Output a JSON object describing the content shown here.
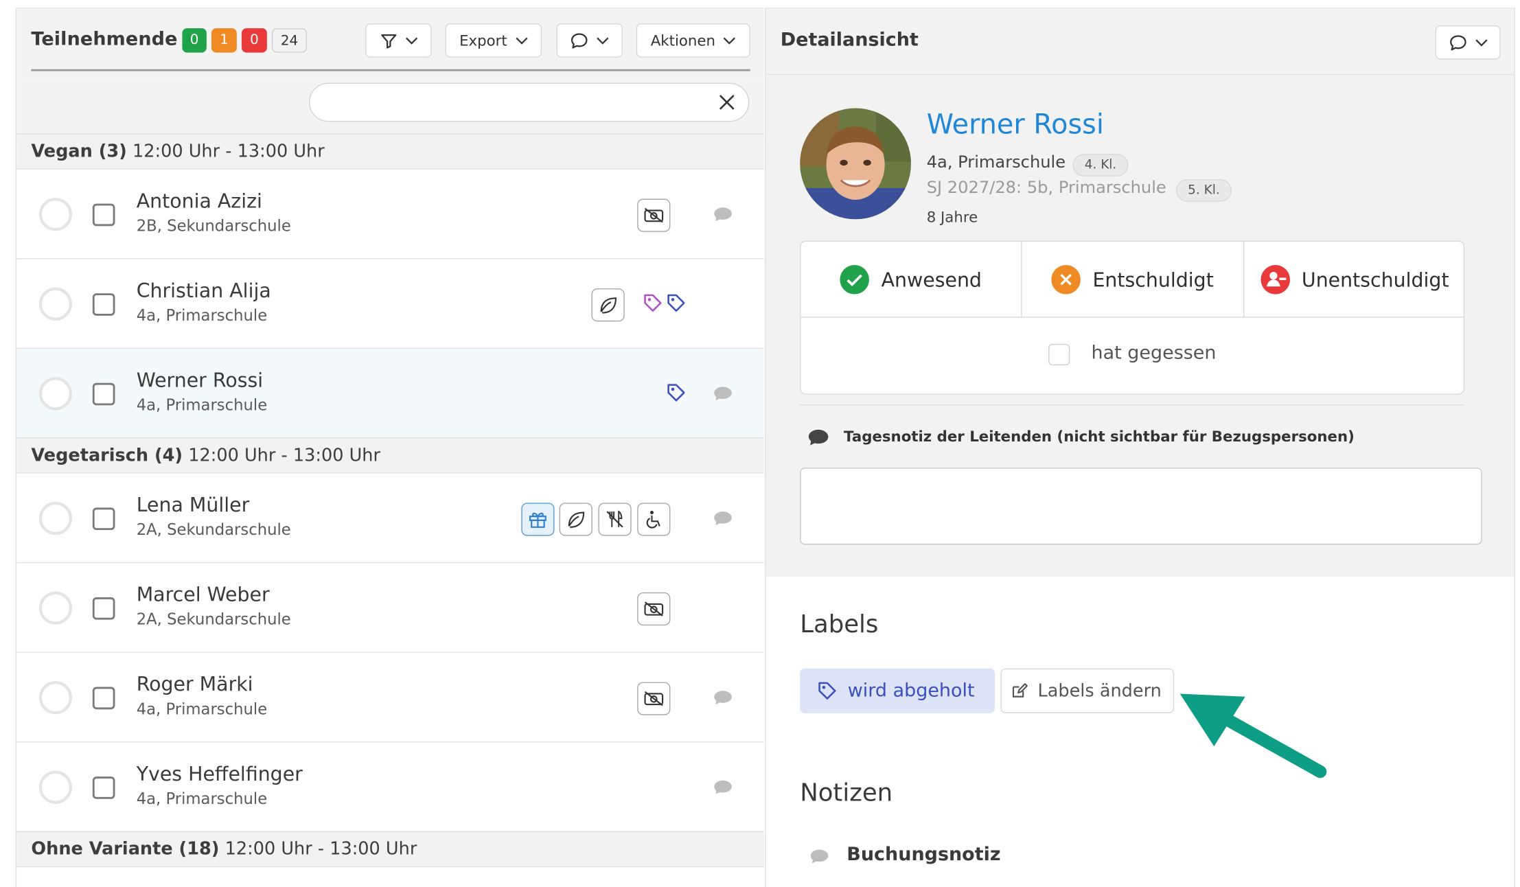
{
  "left_panel": {
    "title": "Teilnehmende",
    "badges": {
      "present": "0",
      "excused": "1",
      "unexcused": "0",
      "total": "24"
    },
    "export_label": "Export",
    "actions_label": "Aktionen",
    "search": {
      "value": "",
      "placeholder": ""
    },
    "groups": [
      {
        "name": "Vegan (3)",
        "time": "12:00 Uhr - 13:00 Uhr"
      },
      {
        "name": "Vegetarisch (4)",
        "time": "12:00 Uhr - 13:00 Uhr"
      },
      {
        "name": "Ohne Variante (18)",
        "time": "12:00 Uhr - 13:00 Uhr"
      }
    ],
    "participants": [
      {
        "name": "Antonia Azizi",
        "class": "2B, Sekundarschule"
      },
      {
        "name": "Christian Alija",
        "class": "4a, Primarschule"
      },
      {
        "name": "Werner Rossi",
        "class": "4a, Primarschule"
      },
      {
        "name": "Lena Müller",
        "class": "2A, Sekundarschule"
      },
      {
        "name": "Marcel Weber",
        "class": "2A, Sekundarschule"
      },
      {
        "name": "Roger Märki",
        "class": "4a, Primarschule"
      },
      {
        "name": "Yves Heffelfinger",
        "class": "4a, Primarschule"
      }
    ],
    "icons": {
      "filter": "filter-funnel-icon",
      "chevron": "chevron-down-icon",
      "comment": "speech-bubble-icon",
      "clear": "close-x-icon",
      "no_photo": "no-photo-icon",
      "leaf": "leaf-icon",
      "tag": "tag-icon",
      "gift": "gift-icon",
      "no_cutlery": "no-cutlery-icon",
      "wheelchair": "wheelchair-icon"
    }
  },
  "detail": {
    "title": "Detailansicht",
    "name": "Werner Rossi",
    "class_line": "4a, Primarschule",
    "class_badge": "4. Kl.",
    "next_year_line": "SJ 2027/28: 5b, Primarschule",
    "next_year_badge": "5. Kl.",
    "age": "8 Jahre",
    "attendance": {
      "present": "Anwesend",
      "excused": "Entschuldigt",
      "unexcused": "Unentschuldigt",
      "ate": "hat gegessen"
    },
    "day_note_label": "Tagesnotiz der Leitenden (nicht sichtbar für Bezugspersonen)",
    "day_note_value": "",
    "labels_heading": "Labels",
    "label_pill": "wird abgeholt",
    "edit_labels": "Labels ändern",
    "notes_heading": "Notizen",
    "booking_note": "Buchungsnotiz"
  },
  "colors": {
    "green": "#20a24b",
    "orange": "#f08a24",
    "red": "#e83a3a",
    "link_blue": "#1f87d6",
    "tag_purple": "#b04fc8",
    "tag_blue": "#3a4fc0",
    "arrow_teal": "#0e9e86"
  }
}
